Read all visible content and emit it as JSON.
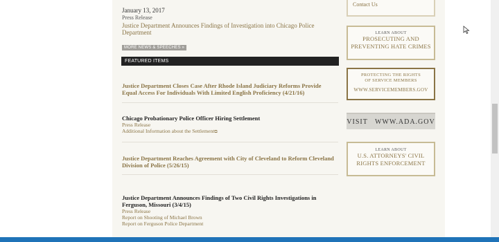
{
  "top_release": {
    "date": "January 13, 2017",
    "type": "Press Release",
    "title": "Justice Department Announces Findings of Investigation into Chicago Police Department"
  },
  "more_button": "MORE NEWS & SPEECHES »",
  "featured_header": "FEATURED ITEMS",
  "featured": [
    {
      "title": "Justice Department Closes Case After Rhode Island Judiciary Reforms Provide Equal Access For Individuals With Limited English Proficiency (4/21/16)"
    },
    {
      "title": "Chicago Probationary Police Officer Hiring Settlement",
      "sub1": "Press Release",
      "sub2": "Additional Information about the Settlement"
    },
    {
      "title": "Justice Department Reaches Agreement with City of Cleveland to Reform Cleveland Division of Police (5/26/15)"
    },
    {
      "title": "Justice Department Announces Findings of Two Civil Rights Investigations in Ferguson, Missouri (3/4/15)",
      "sub1": "Press Release",
      "sub2": "Report on Shooting of Michael Brown",
      "sub3": "Report on Ferguson Police Department"
    }
  ],
  "sidebar": {
    "contact": "Contact Us",
    "hate_crimes": {
      "small": "LEARN ABOUT",
      "line1": "PROSECUTING AND",
      "line2": "PREVENTING HATE CRIMES"
    },
    "servicemembers": {
      "line1": "PROTECTING THE RIGHTS",
      "line2": "OF SERVICE MEMBERS",
      "url": "WWW.SERVICEMEMBERS.GOV"
    },
    "ada": "VISIT   WWW.ADA.GOV",
    "usao": {
      "small": "LEARN ABOUT",
      "line1": "U.S. ATTORNEYS' CIVIL",
      "line2": "RIGHTS ENFORCEMENT"
    }
  }
}
